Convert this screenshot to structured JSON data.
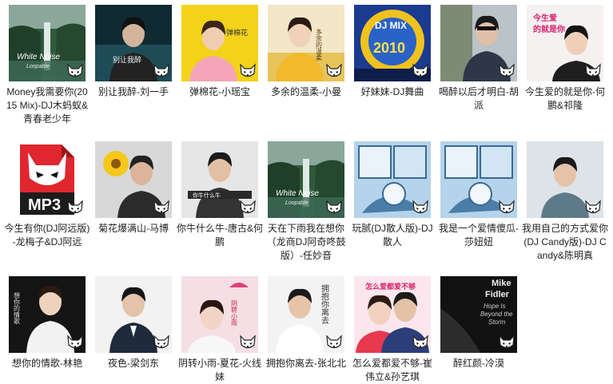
{
  "colors": {
    "text": "#222222",
    "badge_bg": "#ffffff",
    "badge_fg": "#000000"
  },
  "badge_icon": "fox-icon",
  "rows": [
    [
      {
        "title": "Money我需要你(2015 Mix)-DJ木蚂蚁&青春老少年",
        "art": "nature-waterfall",
        "cover_text": "White Noise",
        "cover_text2": "Loopable"
      },
      {
        "title": "别让我醉-刘一手",
        "art": "dark-portrait",
        "cover_text": "别让我醉"
      },
      {
        "title": "弹棉花-小瑶宝",
        "art": "yellow-child",
        "cover_text": "弹棉花"
      },
      {
        "title": "多余的温柔-小曼",
        "art": "yellow-woman",
        "cover_text": "多余的温柔"
      },
      {
        "title": "好妹妹-DJ舞曲",
        "art": "dj-mix",
        "cover_text": "2010",
        "cover_text2": "DJ MIX"
      },
      {
        "title": "喝醉以后才明白-胡派",
        "art": "street-man",
        "cover_text": ""
      },
      {
        "title": "今生爱的就是你-何鹏&祁隆",
        "art": "poster-man",
        "cover_text": "今生爱的就是你"
      }
    ],
    [
      {
        "title": "今生有你(DJ阿远版)-龙梅子&DJ阿远",
        "art": "mp3-file",
        "cover_text": "MP3"
      },
      {
        "title": "菊花爆满山-马博",
        "art": "flower-man",
        "cover_text": ""
      },
      {
        "title": "你牛什么牛-唐古&何鹏",
        "art": "gray-man",
        "cover_text": "你牛什么牛"
      },
      {
        "title": "天在下雨我在想你（龙商DJ阿奇咚鼓版）-任妙音",
        "art": "nature-waterfall",
        "cover_text": "White Noise",
        "cover_text2": "Loopable"
      },
      {
        "title": "玩腻(DJ散人版)-DJ散人",
        "art": "blue-comic",
        "cover_text": ""
      },
      {
        "title": "我是一个爱情傻瓜-莎妞妞",
        "art": "blue-comic",
        "cover_text": ""
      },
      {
        "title": "我用自己的方式爱你(DJ Candy版)-DJ Candy&陈明真",
        "art": "young-man",
        "cover_text": ""
      }
    ],
    [
      {
        "title": "想你的情歌-林艳",
        "art": "woman-dark",
        "cover_text": "想你的情歌"
      },
      {
        "title": "夜色-梁剑东",
        "art": "suit-man",
        "cover_text": ""
      },
      {
        "title": "阴转小雨-夏花-火线妹",
        "art": "pink-girl",
        "cover_text": "阴转小雨"
      },
      {
        "title": "拥抱你离去-张北北",
        "art": "white-man",
        "cover_text": "拥抱你离去"
      },
      {
        "title": "怎么爱都爱不够-崔伟立&孙艺琪",
        "art": "couple",
        "cover_text": "怎么爱都爱不够"
      },
      {
        "title": "醉红颜-冷漠",
        "art": "dark-text",
        "cover_text": "Mike Fidler",
        "cover_text2": "Hope Is Beyond the Storm"
      }
    ]
  ]
}
